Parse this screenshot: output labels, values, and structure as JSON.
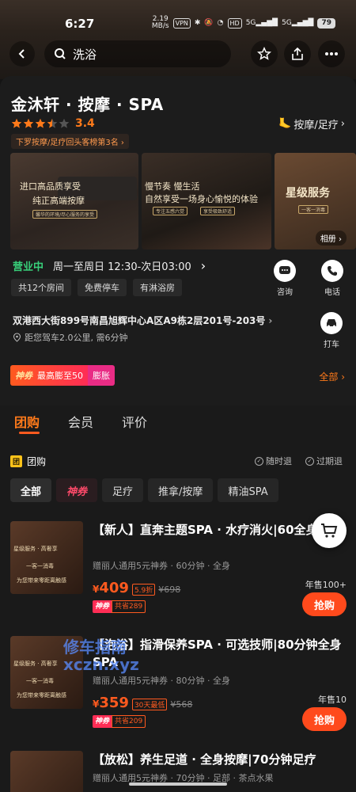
{
  "status_bar": {
    "time": "6:27",
    "speed": "2.19",
    "speed_unit": "MB/s",
    "vpn": "VPN",
    "hd": "HD",
    "signal1": "5G",
    "signal2": "5G",
    "battery": "79"
  },
  "search": {
    "query": "洗浴"
  },
  "store": {
    "name": "金沐轩 · 按摩 · SPA",
    "rating": "3.4",
    "category": "按摩/足疗",
    "rank_badge": "下罗按摩/足疗回头客榜第3名"
  },
  "photos": {
    "p1_line1": "进口高品质享受",
    "p1_line2": "纯正高端按摩",
    "p1_small": "馨华的环境/尽心服务的享受",
    "p2_line1": "慢节奏 慢生活",
    "p2_line2": "自然享受一场身心愉悦的体验",
    "p2_small1": "专注五感六觉",
    "p2_small2": "享受极致舒适",
    "p3_line1": "星级服务",
    "p3_small": "一客一消毒",
    "album_label": "相册"
  },
  "hours": {
    "status": "营业中",
    "time": "周一至周日 12:30-次日03:00"
  },
  "actions": {
    "consult": "咨询",
    "call": "电话",
    "taxi": "打车"
  },
  "facilities": [
    "共12个房间",
    "免费停车",
    "有淋浴房"
  ],
  "address": {
    "line": "双港西大街899号南昌旭辉中心A区A9栋2层201号-203号",
    "distance": "距您驾车2.0公里, 需6分钟"
  },
  "coupon": {
    "brand": "神券",
    "text": "最高膨至50",
    "tag": "膨胀",
    "all": "全部"
  },
  "tabs": [
    "团购",
    "会员",
    "评价"
  ],
  "groupbuy": {
    "icon": "团",
    "title": "团购",
    "refund_any": "随时退",
    "refund_expired": "过期退"
  },
  "filters": [
    "全部",
    "神券",
    "足疗",
    "推拿/按摩",
    "精油SPA"
  ],
  "deals": [
    {
      "title": "【新人】直奔主题SPA · 水疗消火|60全身按摩",
      "sub": "赠丽人通用5元神券 · 60分钟 · 全身",
      "price_symbol": "¥",
      "price": "409",
      "discount": "5.9折",
      "original": "¥698",
      "save_brand": "神券",
      "save": "共省289",
      "sold": "年售100+",
      "buy": "抢购"
    },
    {
      "title": "【泡浴】指滑保养SPA · 可选技师|80分钟全身SPA",
      "sub": "赠丽人通用5元神券 · 80分钟 · 全身",
      "price_symbol": "¥",
      "price": "359",
      "discount": "30天最低",
      "original": "¥568",
      "save_brand": "神券",
      "save": "共省209",
      "sold": "年售10",
      "buy": "抢购"
    },
    {
      "title": "【放松】养生足道 · 全身按摩|70分钟足疗",
      "sub": "赠丽人通用5元神券 · 70分钟 · 足部 · 茶点水果"
    }
  ],
  "deal_img_text": {
    "a": "星级服务 · 高奢享",
    "b": "一客一消毒",
    "c": "为您带来零距离触感"
  },
  "watermark": {
    "line1": "修车指南",
    "line2": "xczn.xyz"
  }
}
